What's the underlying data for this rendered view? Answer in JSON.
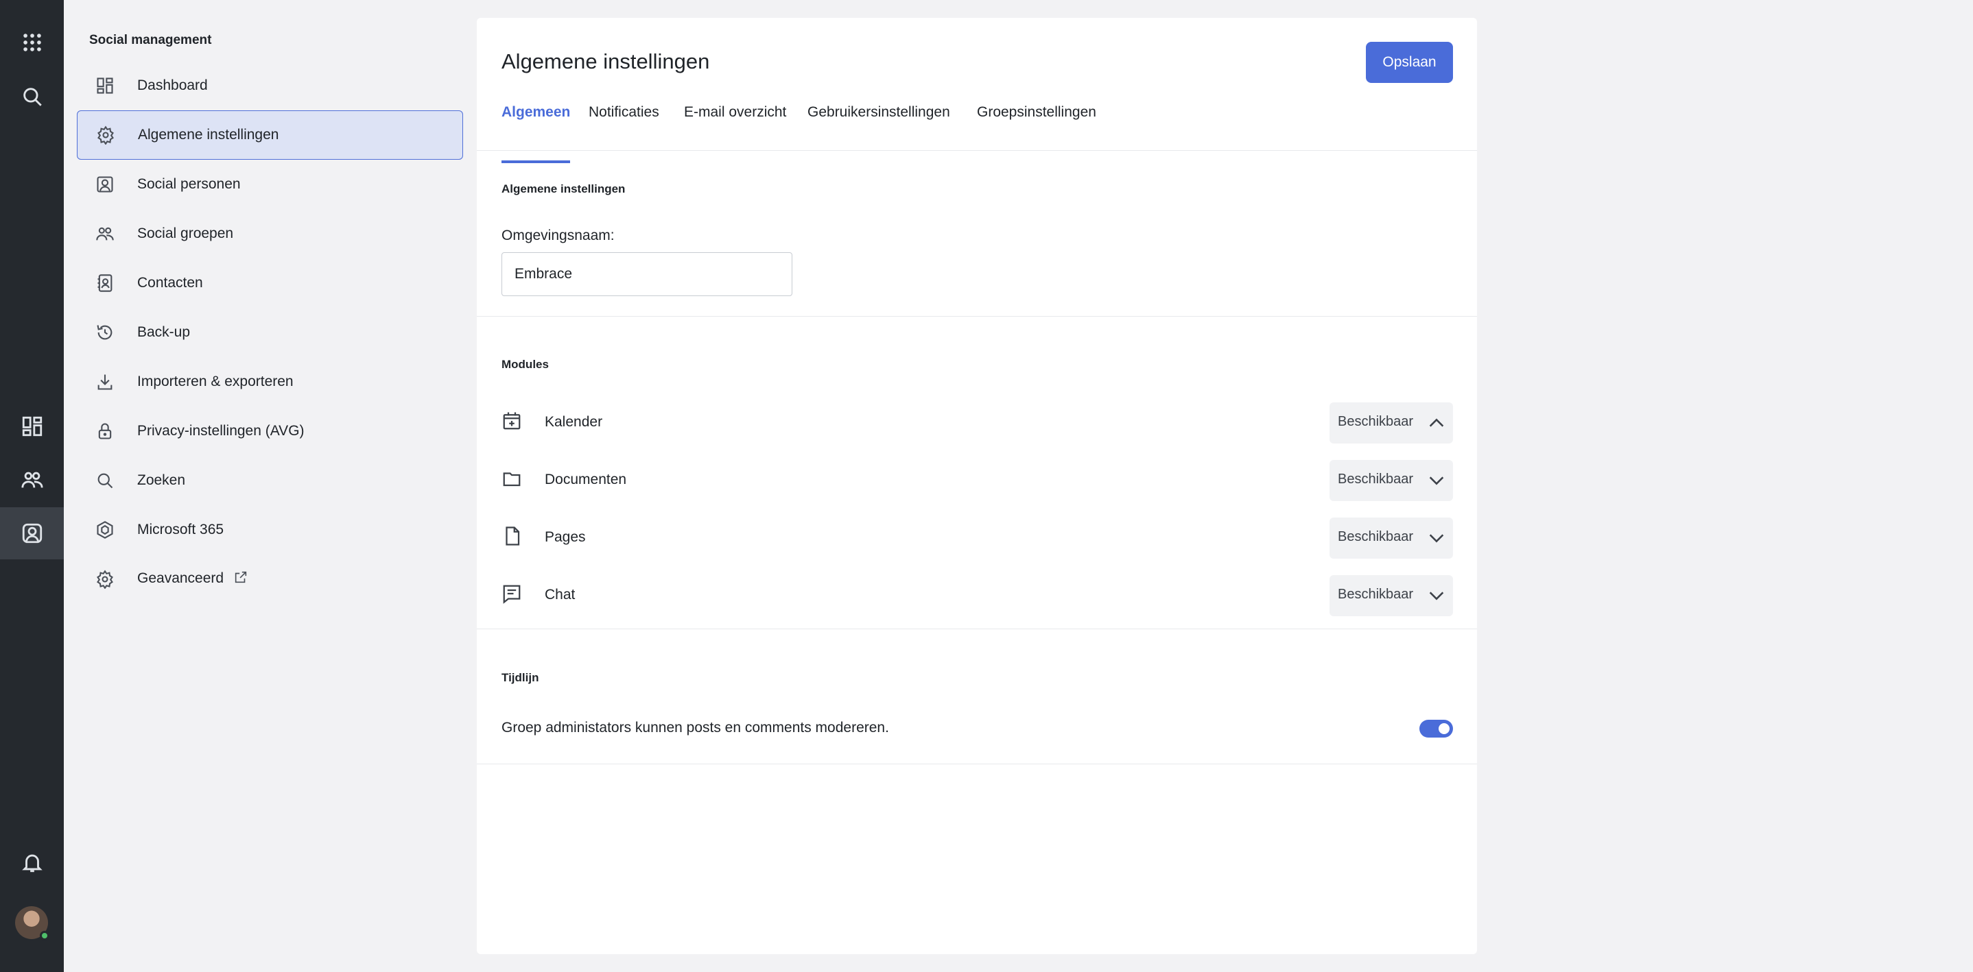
{
  "rail": {
    "icons": [
      "apps-grid-icon",
      "search-icon",
      "dashboard-icon",
      "people-icon",
      "social-person-icon",
      "bell-icon"
    ]
  },
  "sidebar": {
    "title": "Social management",
    "items": [
      {
        "label": "Dashboard",
        "icon": "dashboard-icon"
      },
      {
        "label": "Algemene instellingen",
        "icon": "gear-icon"
      },
      {
        "label": "Social personen",
        "icon": "person-card-icon"
      },
      {
        "label": "Social groepen",
        "icon": "people-icon"
      },
      {
        "label": "Contacten",
        "icon": "contact-book-icon"
      },
      {
        "label": "Back-up",
        "icon": "history-icon"
      },
      {
        "label": "Importeren & exporteren",
        "icon": "download-icon"
      },
      {
        "label": "Privacy-instellingen (AVG)",
        "icon": "lock-icon"
      },
      {
        "label": "Zoeken",
        "icon": "search-icon"
      },
      {
        "label": "Microsoft 365",
        "icon": "hexagon-icon"
      },
      {
        "label": "Geavanceerd",
        "icon": "gear-icon"
      }
    ],
    "active_index": 1
  },
  "main": {
    "title": "Algemene instellingen",
    "save_label": "Opslaan",
    "tabs": [
      {
        "label": "Algemeen"
      },
      {
        "label": "Notificaties"
      },
      {
        "label": "E-mail overzicht"
      },
      {
        "label": "Gebruikersinstellingen"
      },
      {
        "label": "Groepsinstellingen"
      }
    ],
    "active_tab": 0,
    "general": {
      "section_title": "Algemene instellingen",
      "env_label": "Omgevingsnaam:",
      "env_value": "Embrace"
    },
    "modules": {
      "section_title": "Modules",
      "rows": [
        {
          "label": "Kalender",
          "icon": "calendar-icon",
          "value": "Beschikbaar",
          "expanded": true
        },
        {
          "label": "Documenten",
          "icon": "folder-icon",
          "value": "Beschikbaar",
          "expanded": false
        },
        {
          "label": "Pages",
          "icon": "file-icon",
          "value": "Beschikbaar",
          "expanded": false
        },
        {
          "label": "Chat",
          "icon": "chat-icon",
          "value": "Beschikbaar",
          "expanded": false
        }
      ]
    },
    "timeline": {
      "section_title": "Tijdlijn",
      "toggle_label": "Groep administators kunnen posts en comments modereren.",
      "toggle_on": true
    }
  },
  "colors": {
    "accent": "#4a6cd9",
    "rail_bg": "#25292e",
    "active_nav_bg": "#dde3f5"
  }
}
